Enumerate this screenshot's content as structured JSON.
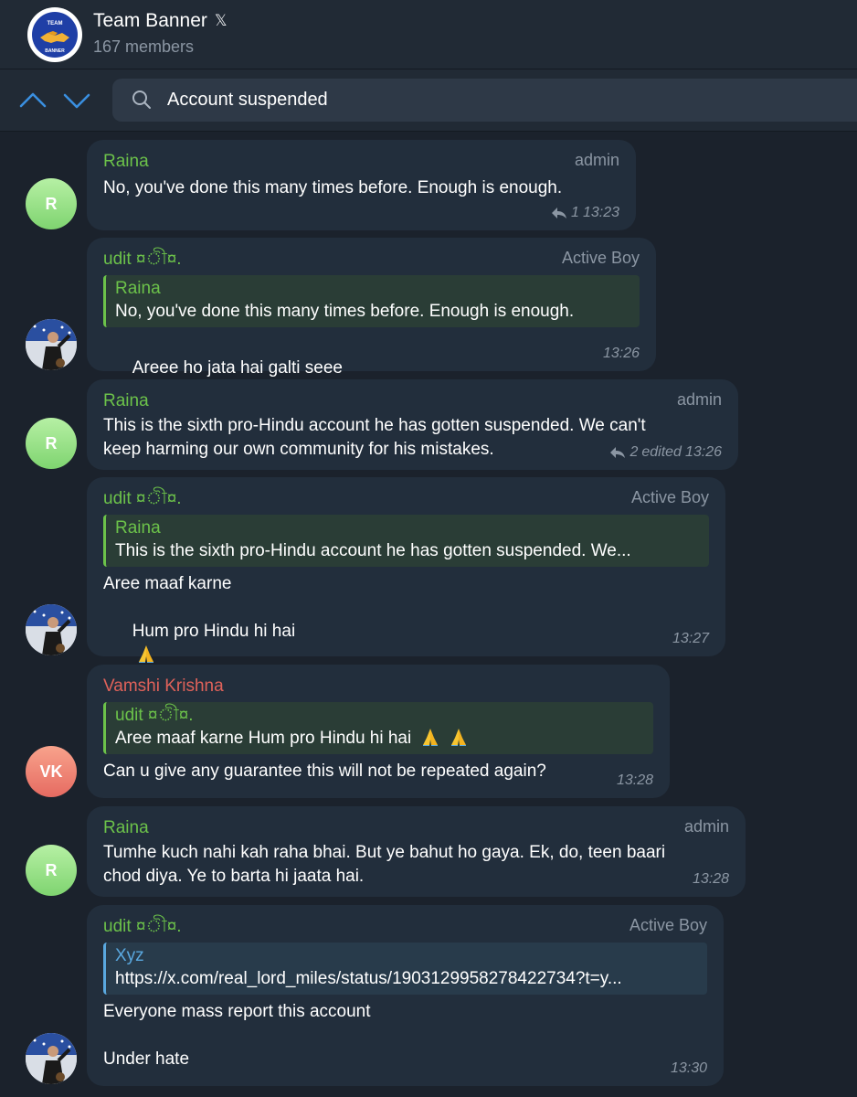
{
  "header": {
    "title": "Team Banner",
    "title_badge": "𝕏",
    "subtitle": "167 members",
    "avatar_text_top": "TEAM",
    "avatar_text_bottom": "BANNER"
  },
  "search": {
    "query": "Account suspended"
  },
  "messages": [
    {
      "avatar": "R",
      "sender": "Raina",
      "role": "admin",
      "text": "No, you've done this many times before. Enough is enough.",
      "replies": "1",
      "time": "13:23"
    },
    {
      "sender": "udit ¤ী¤.",
      "role": "Active Boy",
      "quote_name": "Raina",
      "quote_text": "No, you've done this many times before. Enough is enough.",
      "text": "Areee ho jata hai galti seee",
      "time": "13:26"
    },
    {
      "avatar": "R",
      "sender": "Raina",
      "role": "admin",
      "text": "This is the sixth pro-Hindu account he has gotten suspended. We can't\nkeep harming our own community for his mistakes.",
      "replies": "2",
      "edited": "edited",
      "time": "13:26"
    },
    {
      "sender": "udit ¤ী¤.",
      "role": "Active Boy",
      "quote_name": "Raina",
      "quote_text": "This is the sixth pro-Hindu account he has gotten suspended. We...",
      "text_line1": "Aree maaf karne",
      "text_line2": "Hum pro Hindu hi hai",
      "time": "13:27"
    },
    {
      "avatar": "VK",
      "sender": "Vamshi Krishna",
      "quote_name": "udit ¤ী¤.",
      "quote_text": "Aree maaf karne  Hum pro Hindu hi hai",
      "text": "Can u give any guarantee this will not be repeated again?",
      "time": "13:28"
    },
    {
      "avatar": "R",
      "sender": "Raina",
      "role": "admin",
      "text": "Tumhe kuch nahi kah raha bhai. But ye bahut ho gaya. Ek, do, teen baari\nchod diya. Ye to barta hi jaata hai.",
      "time": "13:28"
    },
    {
      "sender": "udit ¤ী¤.",
      "role": "Active Boy",
      "quote_name": "Xyz",
      "quote_text": "https://x.com/real_lord_miles/status/1903129958278422734?t=y...",
      "text_line1": "Everyone mass report this account",
      "text_line2": "Under hate",
      "time": "13:30"
    }
  ],
  "colors": {
    "background": "#1b222c",
    "bubble": "#222e3c",
    "name_green": "#6cc24a",
    "name_red": "#e0625a",
    "quote_blue": "#5aa8df",
    "muted": "#8b96a3"
  }
}
